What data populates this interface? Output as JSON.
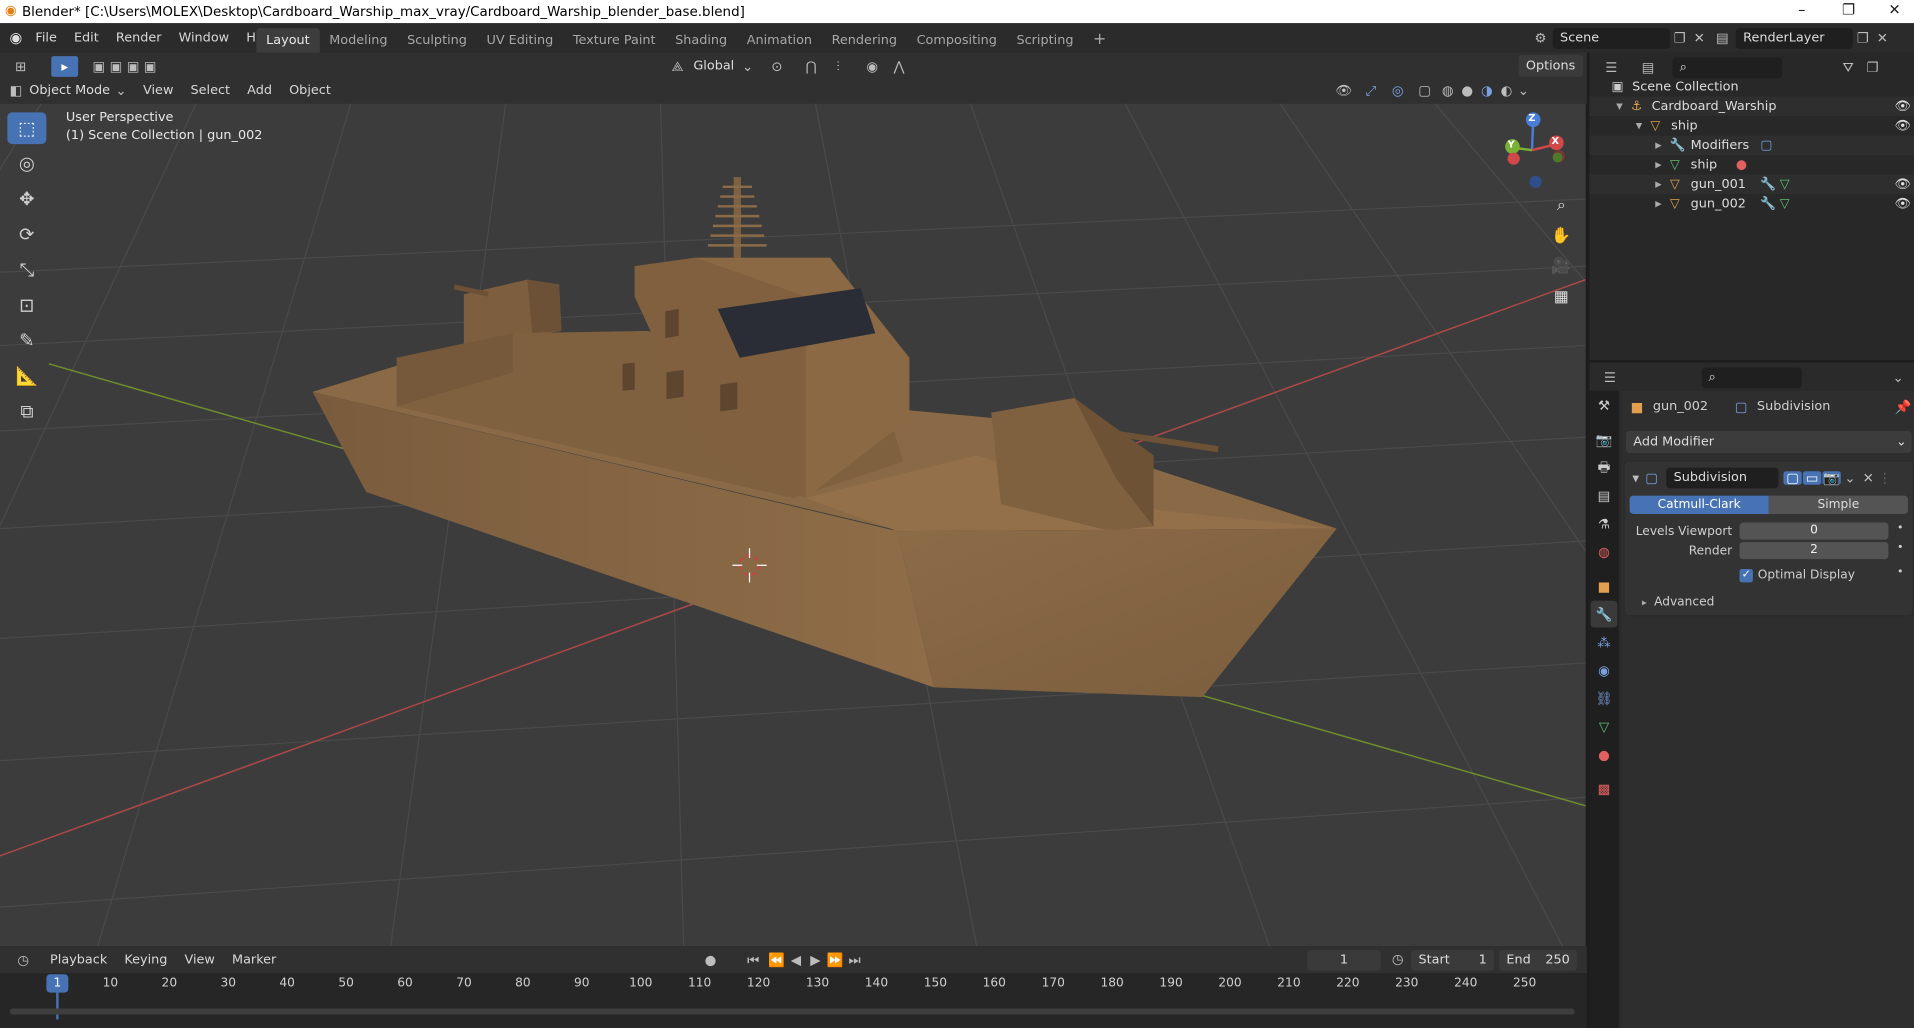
{
  "window": {
    "title": "Blender* [C:\\Users\\MOLEX\\Desktop\\Cardboard_Warship_max_vray/Cardboard_Warship_blender_base.blend]",
    "controls": [
      "–",
      "❐",
      "✕"
    ]
  },
  "menus": [
    "File",
    "Edit",
    "Render",
    "Window",
    "Help"
  ],
  "workspaces": [
    {
      "label": "Layout",
      "active": true
    },
    {
      "label": "Modeling",
      "active": false
    },
    {
      "label": "Sculpting",
      "active": false
    },
    {
      "label": "UV Editing",
      "active": false
    },
    {
      "label": "Texture Paint",
      "active": false
    },
    {
      "label": "Shading",
      "active": false
    },
    {
      "label": "Animation",
      "active": false
    },
    {
      "label": "Rendering",
      "active": false
    },
    {
      "label": "Compositing",
      "active": false
    },
    {
      "label": "Scripting",
      "active": false
    }
  ],
  "add_workspace": "+",
  "scene": {
    "label": "Scene"
  },
  "render_layer": {
    "label": "RenderLayer"
  },
  "tool_header": {
    "transform_orientation": "Global",
    "options": "Options"
  },
  "viewport_header": {
    "mode": "Object Mode",
    "menus": [
      "View",
      "Select",
      "Add",
      "Object"
    ]
  },
  "viewport": {
    "perspective": "User Perspective",
    "collection_info": "(1) Scene Collection | gun_002",
    "gizmo_axes": {
      "x": "X",
      "y": "Y",
      "z": "Z"
    }
  },
  "outliner": {
    "rows": [
      {
        "label": "Scene Collection",
        "indent": 0,
        "icon": "collection-icon"
      },
      {
        "label": "Cardboard_Warship",
        "indent": 1,
        "icon": "object-icon"
      },
      {
        "label": "ship",
        "indent": 2,
        "icon": "mesh-object-icon"
      },
      {
        "label": "Modifiers",
        "indent": 3,
        "icon": "wrench-icon"
      },
      {
        "label": "ship",
        "indent": 3,
        "icon": "mesh-data-icon"
      },
      {
        "label": "gun_001",
        "indent": 3,
        "icon": "mesh-object-icon"
      },
      {
        "label": "gun_002",
        "indent": 3,
        "icon": "mesh-object-icon"
      }
    ]
  },
  "properties": {
    "object_name": "gun_002",
    "modifier_breadcrumb": "Subdivision",
    "add_modifier": "Add Modifier",
    "modifier": {
      "name": "Subdivision",
      "types": [
        {
          "label": "Catmull-Clark",
          "active": true
        },
        {
          "label": "Simple",
          "active": false
        }
      ],
      "levels_viewport": {
        "label": "Levels Viewport",
        "value": "0"
      },
      "render": {
        "label": "Render",
        "value": "2"
      },
      "optimal_display": {
        "label": "Optimal Display",
        "checked": true
      },
      "advanced": "Advanced"
    }
  },
  "timeline": {
    "menus": [
      "Playback",
      "Keying",
      "View",
      "Marker"
    ],
    "current_frame": "1",
    "start": {
      "label": "Start",
      "value": "1"
    },
    "end": {
      "label": "End",
      "value": "250"
    },
    "ticks": [
      "1",
      "10",
      "20",
      "30",
      "40",
      "50",
      "60",
      "70",
      "80",
      "90",
      "100",
      "110",
      "120",
      "130",
      "140",
      "150",
      "160",
      "170",
      "180",
      "190",
      "200",
      "210",
      "220",
      "230",
      "240",
      "250"
    ]
  },
  "colors": {
    "accent": "#4772b3",
    "cardboard": "#8c6b47",
    "axis_x": "#c04040",
    "axis_y": "#6a8a2a"
  }
}
